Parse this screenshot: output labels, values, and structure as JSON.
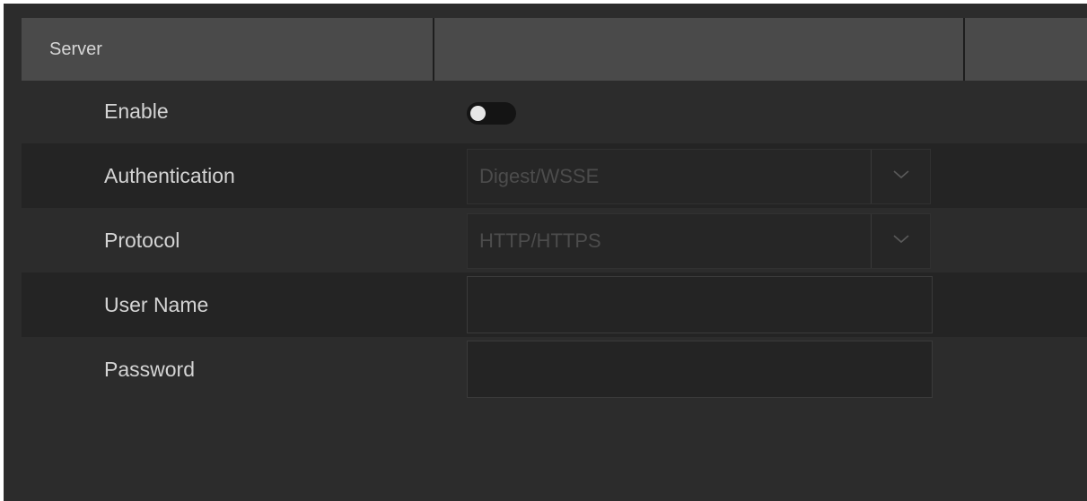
{
  "tabs": [
    {
      "label": "Server"
    },
    {
      "label": ""
    },
    {
      "label": ""
    }
  ],
  "form": {
    "enable": {
      "label": "Enable",
      "value": false
    },
    "authentication": {
      "label": "Authentication",
      "value": "Digest/WSSE",
      "icon": "chevron-down-icon"
    },
    "protocol": {
      "label": "Protocol",
      "value": "HTTP/HTTPS",
      "icon": "chevron-down-icon"
    },
    "user_name": {
      "label": "User Name",
      "value": ""
    },
    "password": {
      "label": "Password",
      "value": ""
    }
  },
  "colors": {
    "background": "#2c2c2c",
    "tab_active": "#4a4a4a",
    "row_shade": "#242424",
    "label_text": "#d4d4d4",
    "disabled_text": "#4c4c4c"
  }
}
